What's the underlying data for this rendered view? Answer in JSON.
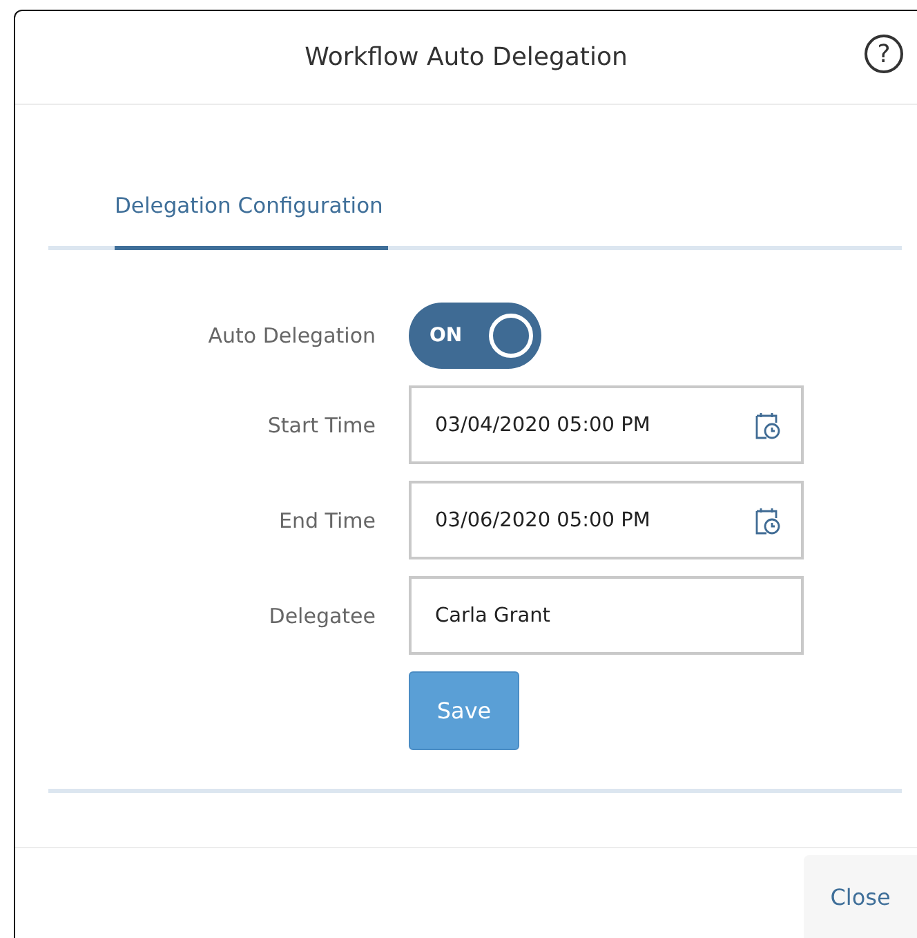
{
  "dialog": {
    "title": "Workflow Auto Delegation",
    "help_icon": "?"
  },
  "tabs": [
    {
      "label": "Delegation Configuration",
      "selected": true
    }
  ],
  "form": [
    {
      "kind": "switch",
      "label": "Auto Delegation",
      "text": "ON",
      "on": true
    },
    {
      "kind": "datetime",
      "label": "Start Time",
      "value": "03/04/2020 05:00 PM"
    },
    {
      "kind": "datetime",
      "label": "End Time",
      "value": "03/06/2020 05:00 PM"
    },
    {
      "kind": "text",
      "label": "Delegatee",
      "value": "Carla Grant"
    }
  ],
  "save_button": "Save",
  "footer": {
    "close_button": "Close"
  }
}
